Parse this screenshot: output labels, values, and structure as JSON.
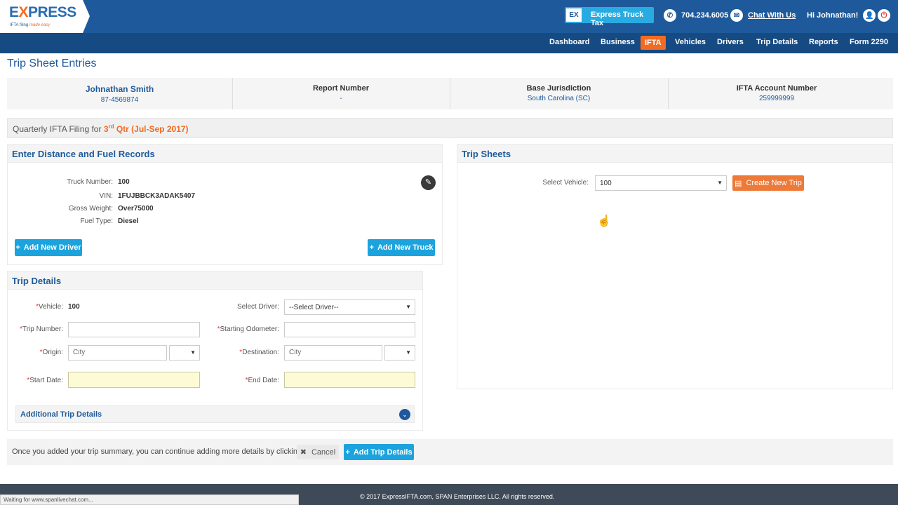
{
  "header": {
    "logo_main_a": "E",
    "logo_main_x": "X",
    "logo_main_b": "PRESS",
    "logo_sub_a": "IFTA filing",
    "logo_sub_b": "made easy",
    "ett_icon": "EX",
    "ett_label": "Express Truck Tax",
    "phone": "704.234.6005",
    "chat": "Chat With Us",
    "greeting": "Hi Johnathan!"
  },
  "nav": [
    "Dashboard",
    "Business",
    "IFTA",
    "Vehicles",
    "Drivers",
    "Trip Details",
    "Reports",
    "Form 2290"
  ],
  "page_title": "Trip Sheet Entries",
  "summary": {
    "name": "Johnathan Smith",
    "ein": "87-4569874",
    "report_label": "Report Number",
    "report_value": "-",
    "base_label": "Base Jurisdiction",
    "base_value": "South Carolina (SC)",
    "acct_label": "IFTA Account Number",
    "acct_value": "259999999"
  },
  "quarter": {
    "prefix": "Quarterly IFTA Filing for ",
    "num": "3",
    "sup": "rd",
    "rest": " Qtr (Jul-Sep 2017)"
  },
  "distance_panel": {
    "title": "Enter Distance and Fuel Records",
    "truck_number_label": "Truck Number:",
    "truck_number": "100",
    "vin_label": "VIN:",
    "vin": "1FUJBBCK3ADAK5407",
    "gross_weight_label": "Gross Weight:",
    "gross_weight": "Over75000",
    "fuel_type_label": "Fuel Type:",
    "fuel_type": "Diesel",
    "add_driver": "Add New Driver",
    "add_truck": "Add New Truck"
  },
  "trip_sheets": {
    "title": "Trip Sheets",
    "select_vehicle_label": "Select Vehicle:",
    "select_vehicle_value": "100",
    "create_trip": "Create New Trip"
  },
  "trip_details": {
    "title": "Trip Details",
    "vehicle_label": "Vehicle:",
    "vehicle_value": "100",
    "select_driver_label": "Select Driver:",
    "select_driver_value": "--Select Driver--",
    "trip_number_label": "Trip Number:",
    "starting_odometer_label": "Starting Odometer:",
    "origin_label": "Origin:",
    "origin_placeholder": "City",
    "destination_label": "Destination:",
    "destination_placeholder": "City",
    "start_date_label": "Start Date:",
    "end_date_label": "End Date:",
    "required_mark": "*",
    "additional": "Additional Trip Details"
  },
  "bottom": {
    "text": "Once you added your trip summary, you can continue adding more details by clicking here",
    "cancel": "Cancel",
    "add_trip": "Add Trip Details"
  },
  "footer": {
    "copyright": "© 2017 ExpressIFTA.com, SPAN Enterprises LLC. All rights reserved.",
    "status": "Waiting for www.spanlivechat.com..."
  },
  "icons": {
    "plus": "+",
    "close": "✖",
    "caret": "▼",
    "chevron": "⌄",
    "pencil": "✎",
    "phone": "✆",
    "chat": "✉",
    "user": "👤",
    "power": "⏻",
    "doc": "▤",
    "cursor": "☝"
  },
  "colors": {
    "brand_blue": "#1e5a9b",
    "nav_blue": "#164a82",
    "accent_orange": "#f26b22",
    "button_blue": "#1ca3dd"
  }
}
